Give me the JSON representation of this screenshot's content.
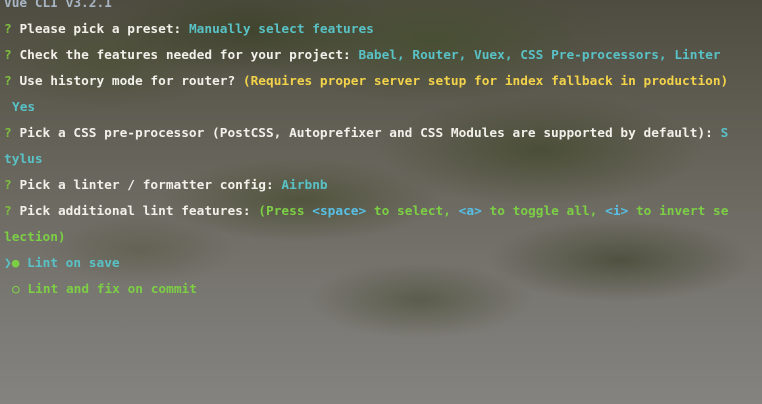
{
  "title": "Vue CLI v3.2.1",
  "prompts": [
    {
      "marker": "?",
      "question": "Please pick a preset:",
      "answer": "Manually select features"
    },
    {
      "marker": "?",
      "question": "Check the features needed for your project:",
      "answer": "Babel, Router, Vuex, CSS Pre-processors, Linter"
    },
    {
      "marker": "?",
      "question": "Use history mode for router?",
      "hint": "(Requires proper server setup for index fallback in production)",
      "answer": "Yes"
    },
    {
      "marker": "?",
      "question_part1": "Pick a CSS pre-processor (PostCSS, Autoprefixer and CSS Modules are supported by default):",
      "answer_part1": "S",
      "answer_part2": "tylus"
    },
    {
      "marker": "?",
      "question": "Pick a linter / formatter config:",
      "answer": "Airbnb"
    },
    {
      "marker": "?",
      "question": "Pick additional lint features:",
      "hint_open": "(Press",
      "key_space": "<space>",
      "hint_mid1": "to select,",
      "key_a": "<a>",
      "hint_mid2": "to toggle all,",
      "key_i": "<i>",
      "hint_mid3": "to invert se",
      "hint_tail": "lection)"
    }
  ],
  "options": [
    {
      "pointer": "❯",
      "bullet": "●",
      "label": "Lint on save"
    },
    {
      "pointer": "",
      "bullet": "○",
      "label": "Lint and fix on commit"
    }
  ],
  "colors": {
    "answer": "#59c2c6",
    "marker": "#7fbf3f",
    "hint_yellow": "#f3d34a",
    "hint_green": "#7ccf45",
    "key": "#58c0e6"
  }
}
